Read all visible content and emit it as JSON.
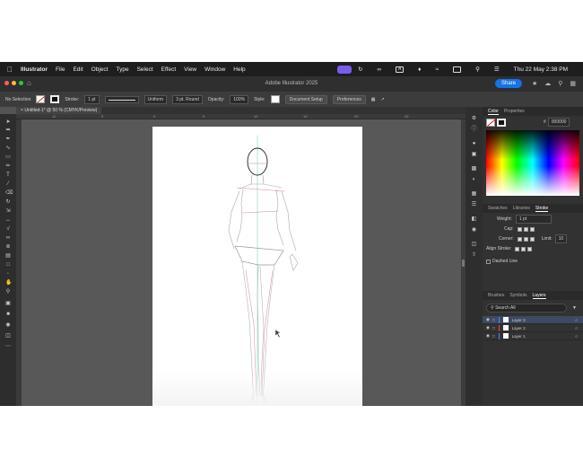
{
  "macmenu": {
    "items": [
      "Illustrator",
      "File",
      "Edit",
      "Object",
      "Type",
      "Select",
      "Effect",
      "View",
      "Window",
      "Help"
    ],
    "clock": "Thu 22 May  2:38 PM"
  },
  "titlebar": {
    "title": "Adobe Illustrator 2025",
    "share_label": "Share"
  },
  "control": {
    "selection": "No Selection",
    "stroke_label": "Stroke:",
    "stroke_weight": "1 pt",
    "profile": "Uniform",
    "brush": "3 pt. Round",
    "opacity_label": "Opacity:",
    "opacity_value": "100%",
    "style_label": "Style:",
    "document_setup": "Document Setup",
    "preferences": "Preferences"
  },
  "document": {
    "tab_label": "Untitled-1* @ 50 % (CMYK/Preview)"
  },
  "ruler": {
    "ticks": [
      "10",
      "5",
      "0",
      "5",
      "10",
      "15",
      "20",
      "25"
    ]
  },
  "color_panel": {
    "tabs": [
      "Color",
      "Properties"
    ],
    "hex": "000000"
  },
  "stroke_panel": {
    "tabs": [
      "Swatches",
      "Libraries",
      "Stroke"
    ],
    "weight_label": "Weight:",
    "weight_value": "1 pt",
    "cap_label": "Cap:",
    "corner_label": "Corner:",
    "limit_label": "Limit:",
    "limit_value": "10",
    "align_label": "Align Stroke:",
    "dashed_label": "Dashed Line"
  },
  "layers_panel": {
    "tabs": [
      "Brushes",
      "Symbols",
      "Layers"
    ],
    "search_placeholder": "Search All",
    "layers": [
      {
        "name": "Layer 3",
        "color": "#4f86f7"
      },
      {
        "name": "Layer 2",
        "color": "#e8453c"
      },
      {
        "name": "Layer 1",
        "color": "#4f86f7"
      }
    ]
  },
  "colors": {
    "accent": "#1473e6",
    "ui_dark": "#323232",
    "canvas": "#585858"
  }
}
